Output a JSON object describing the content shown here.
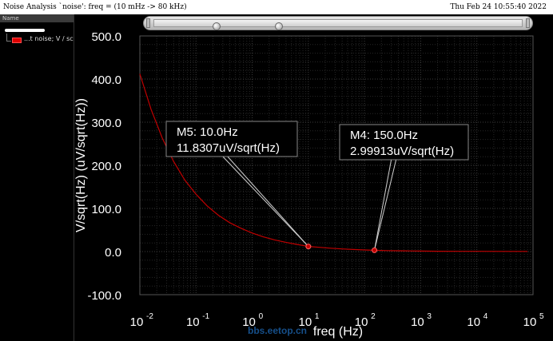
{
  "window": {
    "title": "Noise Analysis `noise': freq = (10 mHz -> 80 kHz)",
    "timestamp": "Thu Feb 24 10:55:40 2022"
  },
  "legend": {
    "header": "Name",
    "entry_label": "...t noise; V / sc",
    "entry_color": "#e00000"
  },
  "chart_data": {
    "type": "line",
    "xlabel": "freq (Hz)",
    "ylabel": "V/sqrt(Hz) (uV/sqrt(Hz))",
    "xscale": "log",
    "xlim": [
      0.01,
      100000
    ],
    "ylim": [
      -100,
      500
    ],
    "x_ticks": [
      {
        "base": "10",
        "exp": "-2",
        "value": 0.01
      },
      {
        "base": "10",
        "exp": "-1",
        "value": 0.1
      },
      {
        "base": "10",
        "exp": "0",
        "value": 1
      },
      {
        "base": "10",
        "exp": "1",
        "value": 10
      },
      {
        "base": "10",
        "exp": "2",
        "value": 100
      },
      {
        "base": "10",
        "exp": "3",
        "value": 1000
      },
      {
        "base": "10",
        "exp": "4",
        "value": 10000
      },
      {
        "base": "10",
        "exp": "5",
        "value": 100000
      }
    ],
    "y_ticks": [
      {
        "label": "500.0",
        "value": 500
      },
      {
        "label": "400.0",
        "value": 400
      },
      {
        "label": "300.0",
        "value": 300
      },
      {
        "label": "200.0",
        "value": 200
      },
      {
        "label": "100.0",
        "value": 100
      },
      {
        "label": "0.0",
        "value": 0
      },
      {
        "label": "-100.0",
        "value": -100
      }
    ],
    "grid": true,
    "background": "#000000",
    "series": [
      {
        "color": "#c00000",
        "points": [
          [
            0.01,
            412
          ],
          [
            0.0158,
            330
          ],
          [
            0.0251,
            263
          ],
          [
            0.0398,
            209
          ],
          [
            0.0631,
            166
          ],
          [
            0.1,
            133
          ],
          [
            0.158,
            106
          ],
          [
            0.251,
            84
          ],
          [
            0.398,
            67
          ],
          [
            0.631,
            54
          ],
          [
            1,
            43
          ],
          [
            1.58,
            34
          ],
          [
            2.51,
            27
          ],
          [
            3.98,
            21.5
          ],
          [
            6.31,
            16.5
          ],
          [
            10,
            11.83
          ],
          [
            15.8,
            9.8
          ],
          [
            25.1,
            7.8
          ],
          [
            39.8,
            6.2
          ],
          [
            63.1,
            4.8
          ],
          [
            100,
            3.7
          ],
          [
            150,
            3.0
          ],
          [
            251,
            2.3
          ],
          [
            398,
            1.8
          ],
          [
            631,
            1.4
          ],
          [
            1000,
            1.1
          ],
          [
            2000,
            0.8
          ],
          [
            5000,
            0.6
          ],
          [
            10000,
            0.5
          ],
          [
            30000,
            0.45
          ],
          [
            80000,
            0.4
          ]
        ]
      }
    ],
    "markers": [
      {
        "name": "M5",
        "x": 10,
        "y": 11.8307,
        "line1": "M5: 10.0Hz",
        "line2": "11.8307uV/sqrt(Hz)"
      },
      {
        "name": "M4",
        "x": 150,
        "y": 2.99913,
        "line1": "M4: 150.0Hz",
        "line2": "2.99913uV/sqrt(Hz)"
      }
    ]
  },
  "watermark": "bbs.eetop.cn"
}
